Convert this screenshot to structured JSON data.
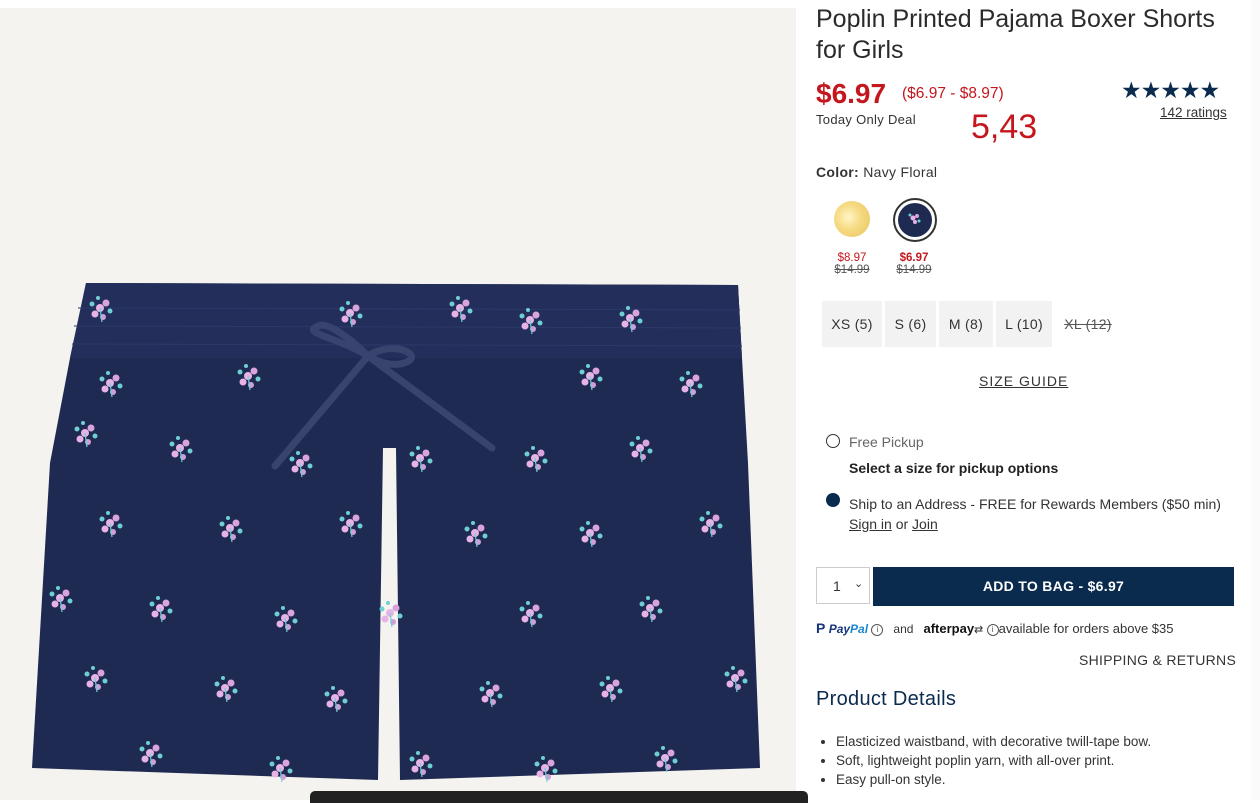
{
  "product": {
    "title": "Poplin Printed Pajama Boxer Shorts for Girls",
    "price": "$6.97",
    "price_range": "($6.97 - $8.97)",
    "deal_label": "Today Only Deal",
    "overlay_number": "5,43",
    "rating_stars": "★★★★★",
    "ratings_count": "142 ratings"
  },
  "color": {
    "label": "Color:",
    "selected": "Navy Floral",
    "swatches": [
      {
        "now": "$8.97",
        "was": "$14.99"
      },
      {
        "now": "$6.97",
        "was": "$14.99"
      }
    ]
  },
  "sizes": [
    {
      "label": "XS (5)",
      "available": true
    },
    {
      "label": "S (6)",
      "available": true
    },
    {
      "label": "M (8)",
      "available": true
    },
    {
      "label": "L (10)",
      "available": true
    },
    {
      "label": "XL (12)",
      "available": false
    }
  ],
  "size_guide": "SIZE GUIDE",
  "fulfillment": {
    "pickup_label": "Free Pickup",
    "pickup_sub": "Select a size for pickup options",
    "ship_text": "Ship to an Address - FREE for Rewards Members ($50 min)",
    "sign_in": "Sign in",
    "or": "or",
    "join": "Join"
  },
  "cart": {
    "qty": "1",
    "add_label": "ADD TO BAG  -  $6.97"
  },
  "payment": {
    "paypal_p": "P",
    "paypal_pay": "Pay",
    "paypal_pal": "Pal",
    "and": "and",
    "afterpay": "afterpay",
    "available_text": "available for orders above $35"
  },
  "shipping_returns": "SHIPPING & RETURNS",
  "details": {
    "title": "Product Details",
    "items": [
      "Elasticized waistband, with decorative twill-tape bow.",
      "Soft, lightweight poplin yarn, with all-over print.",
      "Easy pull-on style."
    ]
  },
  "colors": {
    "sale_red": "#c4161c",
    "navy": "#0a2a4e",
    "fabric": "#1f2a52"
  }
}
